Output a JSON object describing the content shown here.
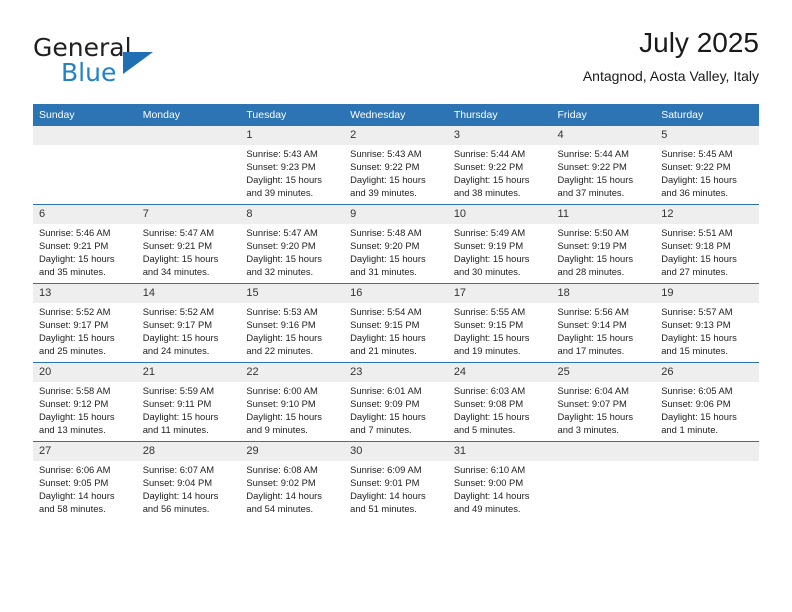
{
  "brand": {
    "name_top": "General",
    "name_bottom": "Blue",
    "triangle_color": "#1f6fb5",
    "blue_color": "#2281c8"
  },
  "header": {
    "title": "July 2025",
    "subtitle": "Antagnod, Aosta Valley, Italy"
  },
  "theme": {
    "header_blue": "#2c74b3",
    "daynum_gray": "#eeeeee"
  },
  "calendar": {
    "weekdays": [
      "Sunday",
      "Monday",
      "Tuesday",
      "Wednesday",
      "Thursday",
      "Friday",
      "Saturday"
    ],
    "weeks": [
      [
        {
          "day": "",
          "sunrise": "",
          "sunset": "",
          "daylight": ""
        },
        {
          "day": "",
          "sunrise": "",
          "sunset": "",
          "daylight": ""
        },
        {
          "day": "1",
          "sunrise": "Sunrise: 5:43 AM",
          "sunset": "Sunset: 9:23 PM",
          "daylight": "Daylight: 15 hours and 39 minutes."
        },
        {
          "day": "2",
          "sunrise": "Sunrise: 5:43 AM",
          "sunset": "Sunset: 9:22 PM",
          "daylight": "Daylight: 15 hours and 39 minutes."
        },
        {
          "day": "3",
          "sunrise": "Sunrise: 5:44 AM",
          "sunset": "Sunset: 9:22 PM",
          "daylight": "Daylight: 15 hours and 38 minutes."
        },
        {
          "day": "4",
          "sunrise": "Sunrise: 5:44 AM",
          "sunset": "Sunset: 9:22 PM",
          "daylight": "Daylight: 15 hours and 37 minutes."
        },
        {
          "day": "5",
          "sunrise": "Sunrise: 5:45 AM",
          "sunset": "Sunset: 9:22 PM",
          "daylight": "Daylight: 15 hours and 36 minutes."
        }
      ],
      [
        {
          "day": "6",
          "sunrise": "Sunrise: 5:46 AM",
          "sunset": "Sunset: 9:21 PM",
          "daylight": "Daylight: 15 hours and 35 minutes."
        },
        {
          "day": "7",
          "sunrise": "Sunrise: 5:47 AM",
          "sunset": "Sunset: 9:21 PM",
          "daylight": "Daylight: 15 hours and 34 minutes."
        },
        {
          "day": "8",
          "sunrise": "Sunrise: 5:47 AM",
          "sunset": "Sunset: 9:20 PM",
          "daylight": "Daylight: 15 hours and 32 minutes."
        },
        {
          "day": "9",
          "sunrise": "Sunrise: 5:48 AM",
          "sunset": "Sunset: 9:20 PM",
          "daylight": "Daylight: 15 hours and 31 minutes."
        },
        {
          "day": "10",
          "sunrise": "Sunrise: 5:49 AM",
          "sunset": "Sunset: 9:19 PM",
          "daylight": "Daylight: 15 hours and 30 minutes."
        },
        {
          "day": "11",
          "sunrise": "Sunrise: 5:50 AM",
          "sunset": "Sunset: 9:19 PM",
          "daylight": "Daylight: 15 hours and 28 minutes."
        },
        {
          "day": "12",
          "sunrise": "Sunrise: 5:51 AM",
          "sunset": "Sunset: 9:18 PM",
          "daylight": "Daylight: 15 hours and 27 minutes."
        }
      ],
      [
        {
          "day": "13",
          "sunrise": "Sunrise: 5:52 AM",
          "sunset": "Sunset: 9:17 PM",
          "daylight": "Daylight: 15 hours and 25 minutes."
        },
        {
          "day": "14",
          "sunrise": "Sunrise: 5:52 AM",
          "sunset": "Sunset: 9:17 PM",
          "daylight": "Daylight: 15 hours and 24 minutes."
        },
        {
          "day": "15",
          "sunrise": "Sunrise: 5:53 AM",
          "sunset": "Sunset: 9:16 PM",
          "daylight": "Daylight: 15 hours and 22 minutes."
        },
        {
          "day": "16",
          "sunrise": "Sunrise: 5:54 AM",
          "sunset": "Sunset: 9:15 PM",
          "daylight": "Daylight: 15 hours and 21 minutes."
        },
        {
          "day": "17",
          "sunrise": "Sunrise: 5:55 AM",
          "sunset": "Sunset: 9:15 PM",
          "daylight": "Daylight: 15 hours and 19 minutes."
        },
        {
          "day": "18",
          "sunrise": "Sunrise: 5:56 AM",
          "sunset": "Sunset: 9:14 PM",
          "daylight": "Daylight: 15 hours and 17 minutes."
        },
        {
          "day": "19",
          "sunrise": "Sunrise: 5:57 AM",
          "sunset": "Sunset: 9:13 PM",
          "daylight": "Daylight: 15 hours and 15 minutes."
        }
      ],
      [
        {
          "day": "20",
          "sunrise": "Sunrise: 5:58 AM",
          "sunset": "Sunset: 9:12 PM",
          "daylight": "Daylight: 15 hours and 13 minutes."
        },
        {
          "day": "21",
          "sunrise": "Sunrise: 5:59 AM",
          "sunset": "Sunset: 9:11 PM",
          "daylight": "Daylight: 15 hours and 11 minutes."
        },
        {
          "day": "22",
          "sunrise": "Sunrise: 6:00 AM",
          "sunset": "Sunset: 9:10 PM",
          "daylight": "Daylight: 15 hours and 9 minutes."
        },
        {
          "day": "23",
          "sunrise": "Sunrise: 6:01 AM",
          "sunset": "Sunset: 9:09 PM",
          "daylight": "Daylight: 15 hours and 7 minutes."
        },
        {
          "day": "24",
          "sunrise": "Sunrise: 6:03 AM",
          "sunset": "Sunset: 9:08 PM",
          "daylight": "Daylight: 15 hours and 5 minutes."
        },
        {
          "day": "25",
          "sunrise": "Sunrise: 6:04 AM",
          "sunset": "Sunset: 9:07 PM",
          "daylight": "Daylight: 15 hours and 3 minutes."
        },
        {
          "day": "26",
          "sunrise": "Sunrise: 6:05 AM",
          "sunset": "Sunset: 9:06 PM",
          "daylight": "Daylight: 15 hours and 1 minute."
        }
      ],
      [
        {
          "day": "27",
          "sunrise": "Sunrise: 6:06 AM",
          "sunset": "Sunset: 9:05 PM",
          "daylight": "Daylight: 14 hours and 58 minutes."
        },
        {
          "day": "28",
          "sunrise": "Sunrise: 6:07 AM",
          "sunset": "Sunset: 9:04 PM",
          "daylight": "Daylight: 14 hours and 56 minutes."
        },
        {
          "day": "29",
          "sunrise": "Sunrise: 6:08 AM",
          "sunset": "Sunset: 9:02 PM",
          "daylight": "Daylight: 14 hours and 54 minutes."
        },
        {
          "day": "30",
          "sunrise": "Sunrise: 6:09 AM",
          "sunset": "Sunset: 9:01 PM",
          "daylight": "Daylight: 14 hours and 51 minutes."
        },
        {
          "day": "31",
          "sunrise": "Sunrise: 6:10 AM",
          "sunset": "Sunset: 9:00 PM",
          "daylight": "Daylight: 14 hours and 49 minutes."
        },
        {
          "day": "",
          "sunrise": "",
          "sunset": "",
          "daylight": ""
        },
        {
          "day": "",
          "sunrise": "",
          "sunset": "",
          "daylight": ""
        }
      ]
    ]
  }
}
